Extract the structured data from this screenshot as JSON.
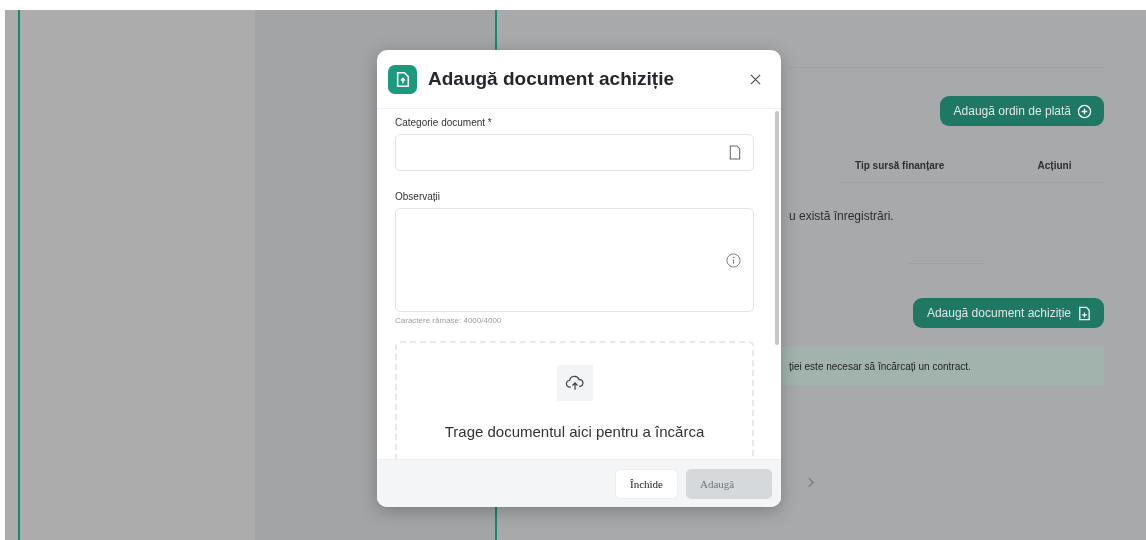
{
  "background": {
    "payment_button": "Adaugă ordin de plată",
    "table": {
      "columns": [
        "Tip sursă finanțare",
        "Acțiuni"
      ],
      "empty_message": "u există înregistrări."
    },
    "document_button": "Adaugă document achiziție",
    "alert": "ției este necesar să încărcați un contract."
  },
  "modal": {
    "title": "Adaugă document achiziție",
    "fields": [
      {
        "kind": "select",
        "label": "Categorie document *"
      },
      {
        "kind": "textarea",
        "label": "Observații",
        "helper": "Caractere rămase: 4000/4000"
      }
    ],
    "dropzone": {
      "text": "Trage documentul aici pentru a încărca"
    },
    "buttons": [
      {
        "label": "Închide",
        "kind": "secondary",
        "disabled": false
      },
      {
        "label": "Adaugă",
        "kind": "primary",
        "disabled": true
      }
    ]
  }
}
